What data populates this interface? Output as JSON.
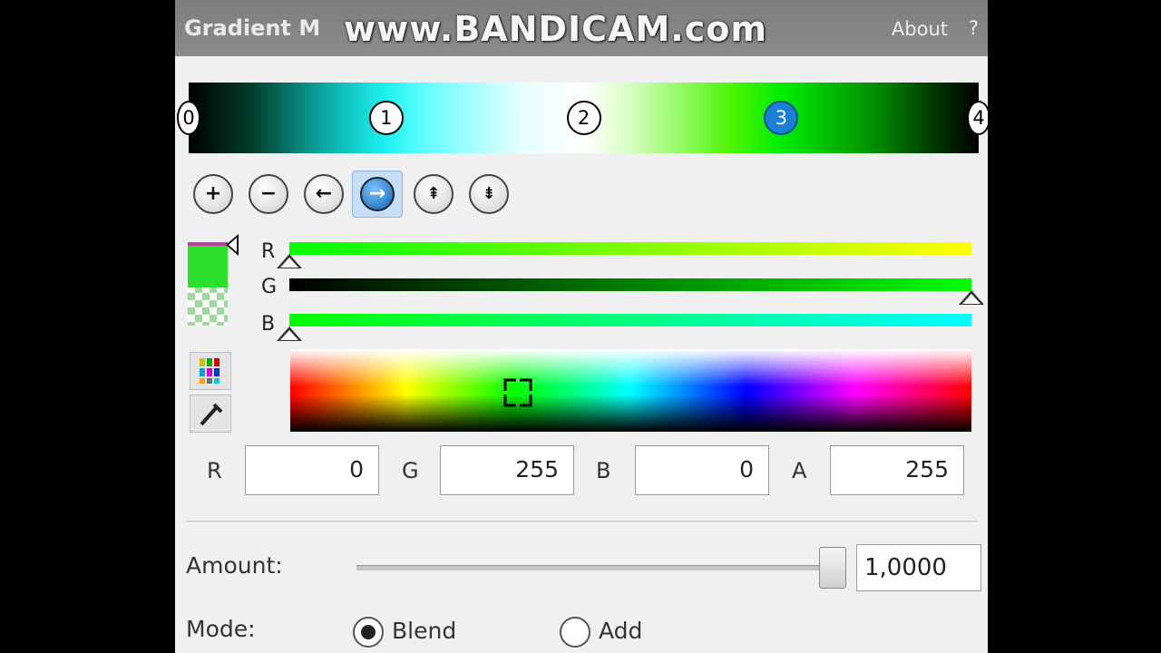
{
  "titlebar": {
    "title": "Gradient M",
    "watermark": "www.BANDICAM.com",
    "about": "About",
    "help": "?"
  },
  "gradient": {
    "stops": [
      {
        "label": "0",
        "position": 0.0,
        "selected": false
      },
      {
        "label": "1",
        "position": 0.25,
        "selected": false
      },
      {
        "label": "2",
        "position": 0.5,
        "selected": false
      },
      {
        "label": "3",
        "position": 0.75,
        "selected": true
      },
      {
        "label": "4",
        "position": 1.0,
        "selected": false
      }
    ]
  },
  "toolbar": {
    "add": "+",
    "remove": "−",
    "move_left": "←",
    "move_right": "→",
    "sort_up": "⇞",
    "sort_down": "⇟"
  },
  "channels": {
    "r_label": "R",
    "g_label": "G",
    "b_label": "B",
    "r_value": 0,
    "g_value": 255,
    "b_value": 0,
    "r_gradient": [
      "#00ff00",
      "#ffff00"
    ],
    "g_gradient": [
      "#000000",
      "#00ff00"
    ],
    "b_gradient": [
      "#00ff00",
      "#00ffff"
    ]
  },
  "values": {
    "r_label": "R",
    "r": "0",
    "g_label": "G",
    "g": "255",
    "b_label": "B",
    "b": "0",
    "a_label": "A",
    "a": "255"
  },
  "amount": {
    "label": "Amount:",
    "value": "1,0000",
    "level": 1.0
  },
  "mode": {
    "label": "Mode:",
    "options": [
      "Blend",
      "Add"
    ],
    "selected": "Blend"
  },
  "colors": {
    "selected_stop": "#1a7fd6",
    "current_color": "#00ff00"
  }
}
